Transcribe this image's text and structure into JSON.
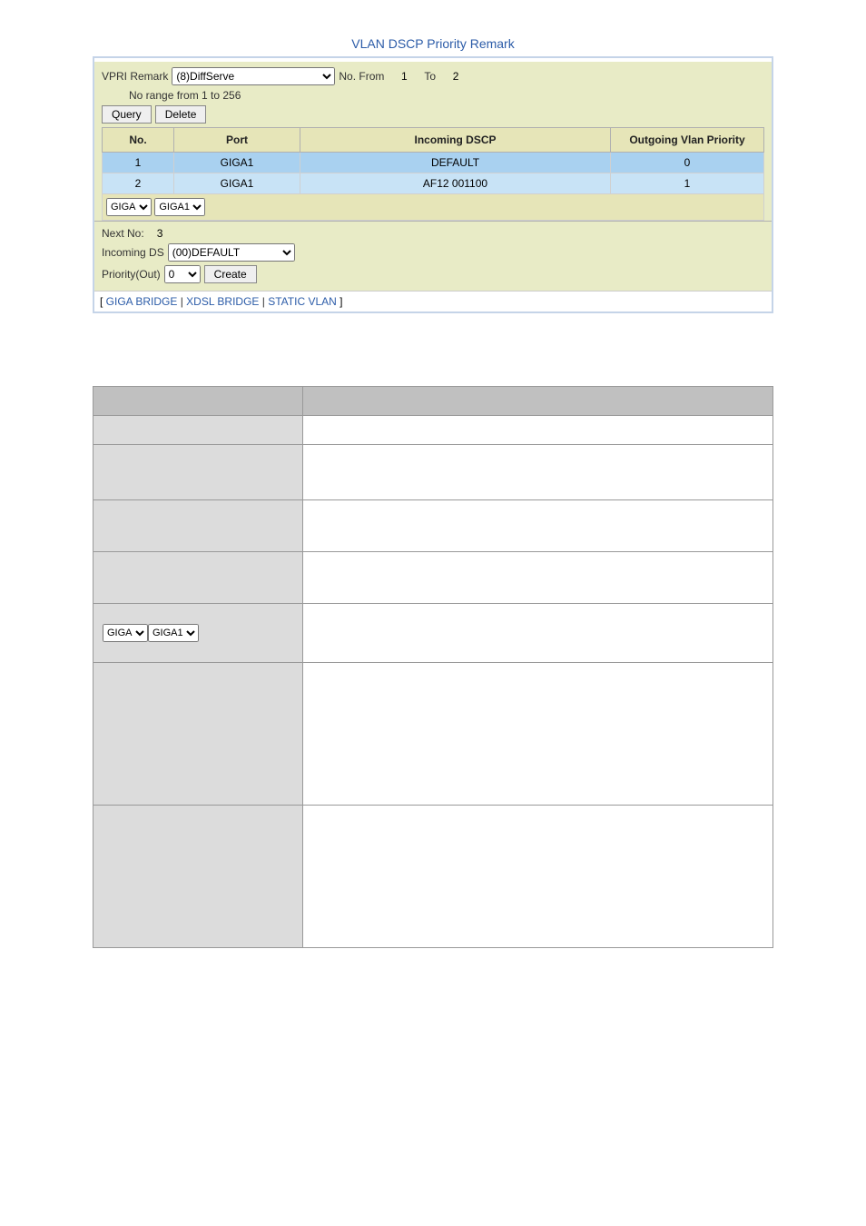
{
  "figure": {
    "title": "VLAN DSCP Priority Remark"
  },
  "controls": {
    "vpri_label": "VPRI Remark",
    "vpri_value": "(8)DiffServe",
    "no_from_label": "No. From",
    "no_from_value": "1",
    "to_label": "To",
    "to_value": "2",
    "no_range_text": "No range from 1 to 256",
    "query_btn": "Query",
    "delete_btn": "Delete"
  },
  "table": {
    "headers": [
      "No.",
      "Port",
      "Incoming DSCP",
      "Outgoing Vlan Priority"
    ],
    "rows": [
      {
        "no": "1",
        "port": "GIGA1",
        "dscp": "DEFAULT",
        "priority": "0"
      },
      {
        "no": "2",
        "port": "GIGA1",
        "dscp": "AF12 001100",
        "priority": "1"
      }
    ],
    "sel1": "GIGA",
    "sel2": "GIGA1"
  },
  "create": {
    "next_no_label": "Next No:",
    "next_no_value": "3",
    "incoming_label": "Incoming DS",
    "incoming_value": "(00)DEFAULT",
    "priority_label": "Priority(Out)",
    "priority_value": "0",
    "create_btn": "Create"
  },
  "nav": {
    "a": "GIGA BRIDGE",
    "b": "XDSL BRIDGE",
    "c": "STATIC VLAN"
  },
  "desc_rows": [
    [
      "",
      ""
    ],
    [
      "",
      ""
    ],
    [
      "",
      ""
    ],
    [
      "",
      ""
    ],
    [
      "",
      ""
    ],
    [
      "DROPDOWN",
      ""
    ],
    [
      "",
      ""
    ],
    [
      "",
      ""
    ]
  ]
}
